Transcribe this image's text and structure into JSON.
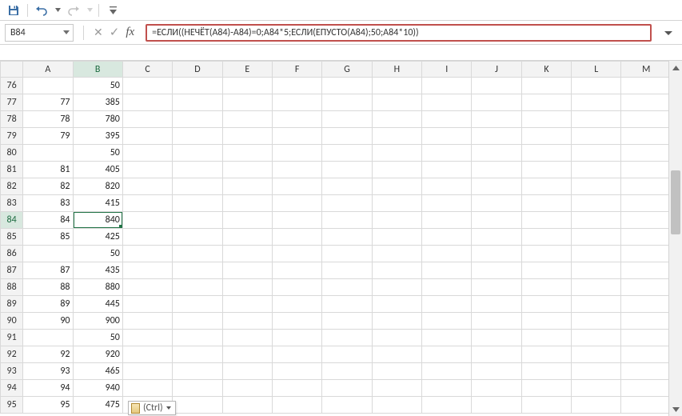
{
  "qat": {
    "save": "save-icon",
    "undo": "undo-icon",
    "redo": "redo-icon",
    "customize": "customize-icon"
  },
  "nameBox": {
    "value": "B84"
  },
  "formulaBar": {
    "cancel": "✕",
    "accept": "✓",
    "fx": "fx",
    "value": "=ЕСЛИ((НЕЧЁТ(A84)-A84)=0;A84*5;ЕСЛИ(ЕПУСТО(A84);50;A84*10))"
  },
  "columns": [
    "A",
    "B",
    "C",
    "D",
    "E",
    "F",
    "G",
    "H",
    "I",
    "J",
    "K",
    "L",
    "M"
  ],
  "rows": [
    {
      "r": 76,
      "A": "",
      "B": "50"
    },
    {
      "r": 77,
      "A": "77",
      "B": "385"
    },
    {
      "r": 78,
      "A": "78",
      "B": "780"
    },
    {
      "r": 79,
      "A": "79",
      "B": "395"
    },
    {
      "r": 80,
      "A": "",
      "B": "50"
    },
    {
      "r": 81,
      "A": "81",
      "B": "405"
    },
    {
      "r": 82,
      "A": "82",
      "B": "820"
    },
    {
      "r": 83,
      "A": "83",
      "B": "415"
    },
    {
      "r": 84,
      "A": "84",
      "B": "840"
    },
    {
      "r": 85,
      "A": "85",
      "B": "425"
    },
    {
      "r": 86,
      "A": "",
      "B": "50"
    },
    {
      "r": 87,
      "A": "87",
      "B": "435"
    },
    {
      "r": 88,
      "A": "88",
      "B": "880"
    },
    {
      "r": 89,
      "A": "89",
      "B": "445"
    },
    {
      "r": 90,
      "A": "90",
      "B": "900"
    },
    {
      "r": 91,
      "A": "",
      "B": "50"
    },
    {
      "r": 92,
      "A": "92",
      "B": "920"
    },
    {
      "r": 93,
      "A": "93",
      "B": "465"
    },
    {
      "r": 94,
      "A": "94",
      "B": "940"
    },
    {
      "r": 95,
      "A": "95",
      "B": "475"
    }
  ],
  "selection": {
    "cell": "B84",
    "row": 84,
    "col": "B"
  },
  "pasteOptions": {
    "label": "(Ctrl)"
  }
}
